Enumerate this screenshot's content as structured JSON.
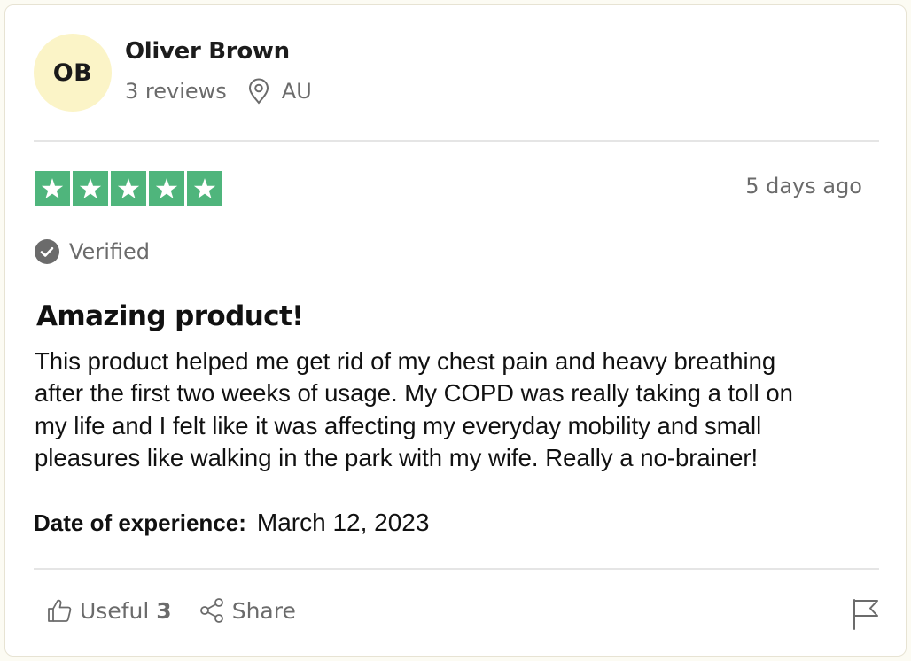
{
  "reviewer": {
    "initials": "OB",
    "name": "Oliver Brown",
    "reviews": "3 reviews",
    "location": "AU"
  },
  "rating": {
    "stars": 5,
    "max": 5,
    "color": "#4fb57c"
  },
  "posted": "5 days ago",
  "verified_label": "Verified",
  "review": {
    "title": "Amazing product!",
    "lines": [
      "This product helped me get rid of my chest pain and heavy breathing",
      "after the first two weeks of usage. My COPD was really taking a toll on",
      "my life and I felt like it was affecting my everyday mobility and small",
      "pleasures like walking in the park with my wife. Really a no-brainer!"
    ]
  },
  "experience": {
    "label": "Date of experience:",
    "value": "March 12, 2023"
  },
  "actions": {
    "useful_label": "Useful",
    "useful_count": "3",
    "share_label": "Share"
  },
  "icons": [
    "location-pin-icon",
    "star-icon",
    "check-circle-icon",
    "thumbs-up-icon",
    "share-icon",
    "flag-icon"
  ]
}
